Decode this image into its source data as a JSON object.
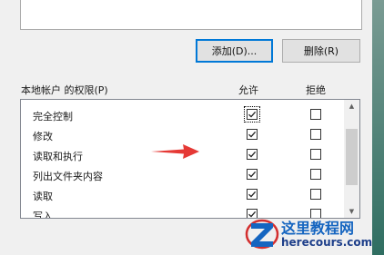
{
  "buttons": {
    "add": "添加(D)...",
    "remove": "删除(R)"
  },
  "permissions": {
    "header": "本地帐户 的权限(P)",
    "allow_col": "允许",
    "deny_col": "拒绝",
    "rows": [
      {
        "name": "完全控制",
        "allow": true,
        "deny": false
      },
      {
        "name": "修改",
        "allow": true,
        "deny": false
      },
      {
        "name": "读取和执行",
        "allow": true,
        "deny": false
      },
      {
        "name": "列出文件夹内容",
        "allow": true,
        "deny": false
      },
      {
        "name": "读取",
        "allow": true,
        "deny": false
      },
      {
        "name": "写入",
        "allow": true,
        "deny": false
      }
    ]
  },
  "watermark": {
    "title": "这里教程网",
    "url": "herecours.com"
  },
  "colors": {
    "accent": "#0078d7",
    "annotation_arrow": "#e53935"
  }
}
